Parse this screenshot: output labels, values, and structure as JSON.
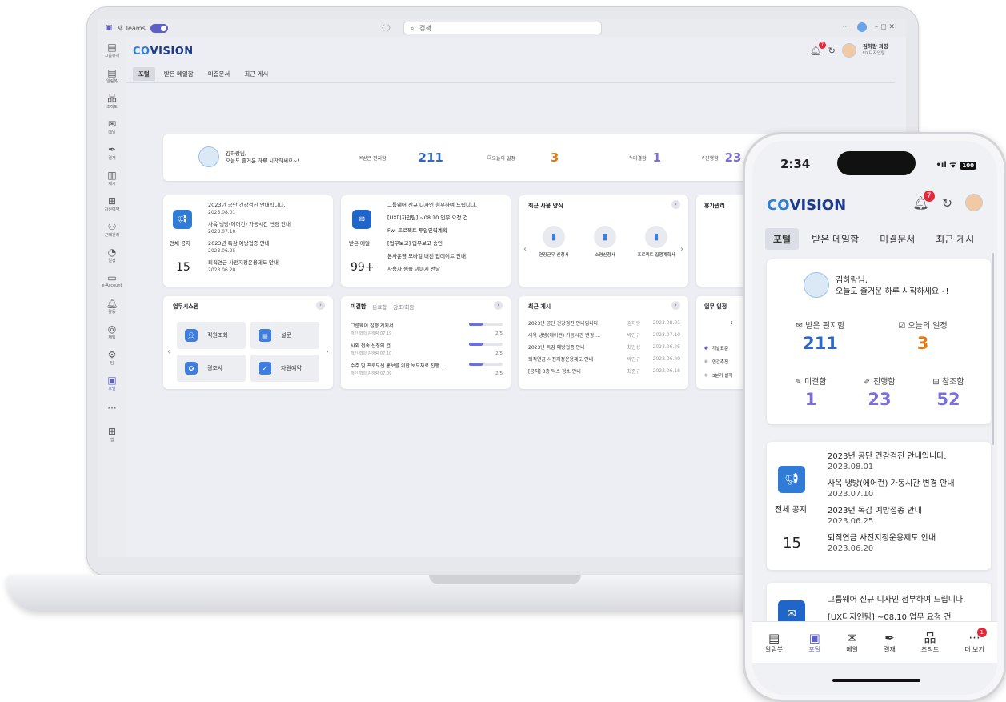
{
  "titlebar": {
    "app_name": "새 Teams",
    "search_placeholder": "검색",
    "nav": "〈  〉",
    "more": "···",
    "window_controls": "–   ◻   ✕"
  },
  "rail": [
    {
      "icon": "chat-icon",
      "label": "그룹뷰어"
    },
    {
      "icon": "message-icon",
      "label": "알림봇"
    },
    {
      "icon": "org-icon",
      "label": "조직도"
    },
    {
      "icon": "mail-icon",
      "label": "메일"
    },
    {
      "icon": "pen-icon",
      "label": "결재"
    },
    {
      "icon": "board-icon",
      "label": "게시"
    },
    {
      "icon": "grid-icon",
      "label": "자원예약"
    },
    {
      "icon": "people-icon",
      "label": "근태관리"
    },
    {
      "icon": "clock-icon",
      "label": "일정"
    },
    {
      "icon": "window-icon",
      "label": "e-Account"
    },
    {
      "icon": "bell-icon",
      "label": "활동"
    },
    {
      "icon": "chat2-icon",
      "label": "채팅"
    },
    {
      "icon": "team-icon",
      "label": "팀"
    },
    {
      "icon": "portal-icon",
      "label": "포털"
    },
    {
      "icon": "more-icon",
      "label": ""
    },
    {
      "icon": "add-icon",
      "label": "앱"
    }
  ],
  "app": {
    "logo_a": "CO",
    "logo_b": "VISION",
    "user_name": "김하랑 과장",
    "user_dept": "UX디자인팀",
    "notifications": "7",
    "tabs": [
      "포털",
      "받은 메일함",
      "미결문서",
      "최근 게시"
    ]
  },
  "summary": {
    "greeting_name": "김하랑님,",
    "greeting_msg": "오늘도 즐거운 하루 시작하세요~!",
    "mail_label": "받은 편지함",
    "mail_count": "211",
    "schedule_label": "오늘의 일정",
    "schedule_count": "3",
    "pending_label": "미결함",
    "pending_count": "1",
    "progress_label": "진행함",
    "progress_count": "23",
    "ref_label": "참조함",
    "ref_count": "52"
  },
  "notice": {
    "label": "전체 공지",
    "count": "15",
    "items": [
      {
        "title": "2023년 공단 건강검진 안내입니다.",
        "date": "2023.08.01"
      },
      {
        "title": "사옥 냉방(에어컨) 가동시간 변경 안내",
        "date": "2023.07.10"
      },
      {
        "title": "2023년 독감 예방접종 안내",
        "date": "2023.06.25"
      },
      {
        "title": "퇴직연금 사전지정운용제도 안내",
        "date": "2023.06.20"
      }
    ]
  },
  "mail": {
    "label": "받은 메일",
    "count": "99+",
    "items": [
      "그룹웨어 신규 디자인 첨부하여 드립니다.",
      "[UX디자인팀] ~08.10 업무 요청 건",
      "Fw: 프로젝트 투입인력계획",
      "[업무보고] 업무보고 승인",
      "본사운영 모바일 버전 업데이트 안내",
      "사용자 샘플 이미지 전달"
    ]
  },
  "forms": {
    "title": "최근 사용 양식",
    "items": [
      "연장근무 신청서",
      "소명신청서",
      "프로젝트 집행계획서"
    ]
  },
  "leave": {
    "title": "휴가관리"
  },
  "work_systems": {
    "title": "업무시스템",
    "items": [
      "직원조회",
      "설문",
      "경조사",
      "자원예약"
    ]
  },
  "approval": {
    "tabs": [
      "미결함",
      "완료함",
      "참조/회람"
    ],
    "items": [
      {
        "title": "그룹웨어 집행 계획서",
        "meta": "개인 협의   김하랑   07.19",
        "step": "2/5",
        "progress": 0.4
      },
      {
        "title": "사외 접속 신청의 건",
        "meta": "개인 협의   김하랑   07.10",
        "step": "2/5",
        "progress": 0.4
      },
      {
        "title": "수주 및 프로모션 홍보를 위한 보도자료 진행…",
        "meta": "개인 협의   김하랑   07.09",
        "step": "2/5",
        "progress": 0.4
      }
    ]
  },
  "recent_posts": {
    "title": "최근 게시",
    "items": [
      {
        "title": "2023년 공단 건강검진 안내입니다.",
        "author": "김하랑",
        "date": "2023.08.01"
      },
      {
        "title": "사옥 냉방(에어컨) 가동시간 변경 …",
        "author": "박민규",
        "date": "2023.07.10"
      },
      {
        "title": "2023년 독감 예방접종 안내",
        "author": "최민성",
        "date": "2023.06.25"
      },
      {
        "title": "퇴직연금 사전지정운용제도 안내",
        "author": "박민규",
        "date": "2023.06.20"
      },
      {
        "title": "[공지] 3층 탁스 청소 안내",
        "author": "최준규",
        "date": "2023.06.18"
      }
    ]
  },
  "schedule": {
    "title": "업무 일정",
    "items": [
      "개발표준",
      "연간추진",
      "3분기 실적"
    ]
  },
  "phone": {
    "time": "2:34",
    "signal": "•ıl ᯤ",
    "battery": "100",
    "nav": [
      {
        "icon": "chat-icon",
        "label": "알림봇"
      },
      {
        "icon": "portal-icon",
        "label": "포털"
      },
      {
        "icon": "mail-icon",
        "label": "메일"
      },
      {
        "icon": "pen-icon",
        "label": "결재"
      },
      {
        "icon": "org-icon",
        "label": "조직도"
      },
      {
        "icon": "more-icon",
        "label": "더 보기",
        "badge": "1"
      }
    ]
  }
}
